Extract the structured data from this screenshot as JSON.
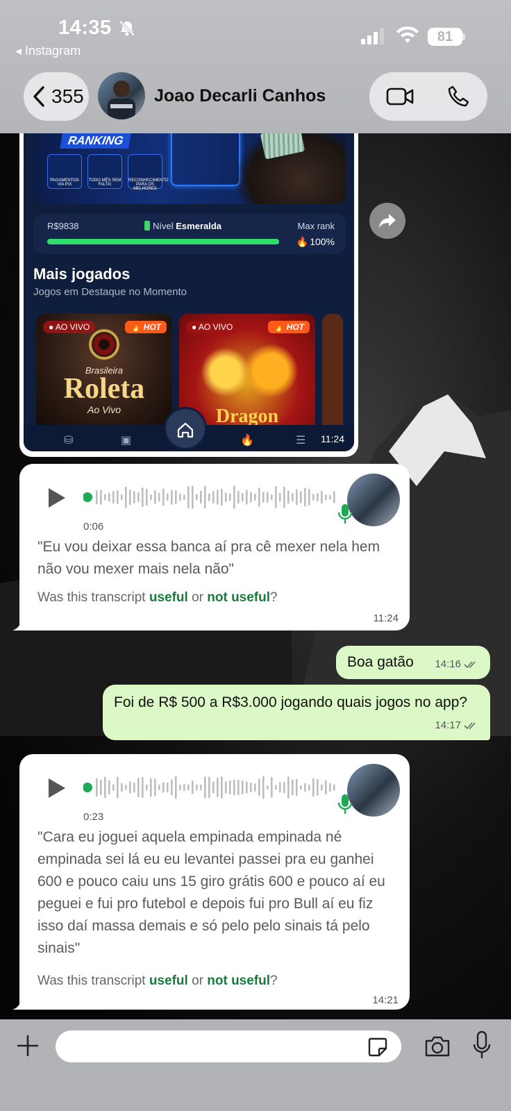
{
  "status_bar": {
    "time": "14:35",
    "back_app": "◂ Instagram",
    "battery": "81"
  },
  "header": {
    "back_count": "355",
    "contact_name": "Joao Decarli Canhos"
  },
  "image_message": {
    "banner_tag": "RANKING",
    "banner_icon_labels": [
      "PAGAMENTOS VIA PIX",
      "TODO MÊS SEM FALTA!",
      "RECONHECIMENTO PARA OS MELHORES"
    ],
    "rank_amount": "R$9838",
    "level_label": "Nível",
    "level_name": "Esmeralda",
    "max_rank_label": "Max rank",
    "rank_progress_percent": 100,
    "rank_percent_text": "100%",
    "section_title": "Mais jogados",
    "section_subtitle": "Jogos em Destaque no Momento",
    "games": [
      {
        "live": "AO VIVO",
        "hot": "HOT",
        "pre": "Brasileira",
        "title": "Roleta",
        "post": "Ao Vivo"
      },
      {
        "live": "AO VIVO",
        "hot": "HOT",
        "title": "Dragon"
      }
    ],
    "time": "11:24"
  },
  "voice1": {
    "duration": "0:06",
    "transcript": "\"Eu vou deixar essa banca aí pra cê mexer nela hem não vou mexer mais nela não\"",
    "feedback_pre": "Was this transcript ",
    "useful": "useful",
    "or": " or ",
    "not_useful": "not useful",
    "q": "?",
    "time": "11:24"
  },
  "outgoing1": {
    "text": "Boa gatão",
    "time": "14:16"
  },
  "outgoing2": {
    "text": "Foi de R$ 500 a R$3.000 jogando quais jogos no app?",
    "time": "14:17"
  },
  "voice2": {
    "duration": "0:23",
    "transcript": "\"Cara eu joguei aquela empinada empinada né empinada sei lá eu eu levantei passei pra eu ganhei 600 e pouco caiu uns 15 giro grátis 600 e pouco aí eu peguei e fui pro futebol e depois fui pro Bull aí eu fiz isso daí massa demais e só pelo pelo sinais tá pelo sinais\"",
    "feedback_pre": "Was this transcript ",
    "useful": "useful",
    "or": " or ",
    "not_useful": "not useful",
    "q": "?",
    "time": "14:21"
  },
  "composer": {
    "placeholder": ""
  },
  "colors": {
    "outgoing_bubble": "#dcf8c6",
    "link_green": "#1a7a3c",
    "progress_green": "#2ee06a",
    "header_bg": "#b4b5b8"
  }
}
